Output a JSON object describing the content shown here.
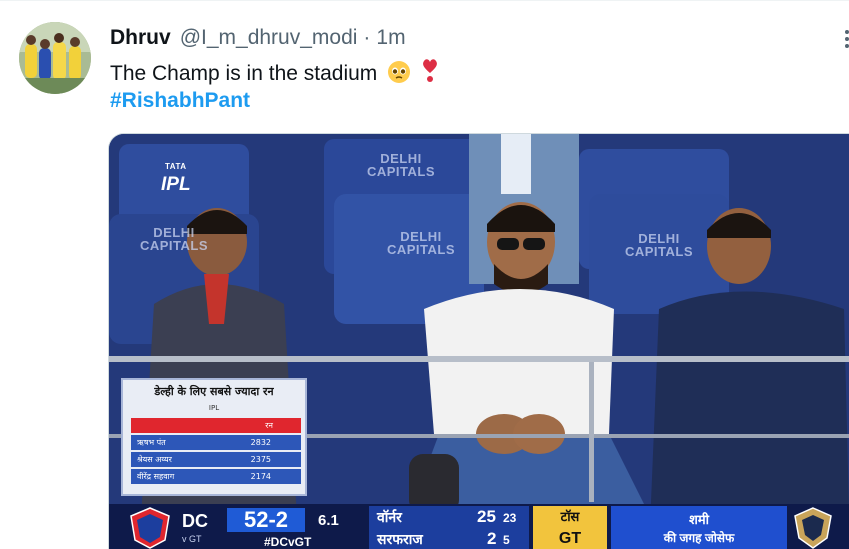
{
  "colors": {
    "text": "#0f1419",
    "secondary": "#536471",
    "link": "#1d9bf0",
    "heart": "#e0245e"
  },
  "tweet": {
    "author_name": "Dhruv",
    "handle": "@I_m_dhruv_modi",
    "separator": "·",
    "timestamp": "1m",
    "text": "The Champ is in the stadium",
    "emojis": [
      "pleading-face-icon",
      "heart-exclamation-icon"
    ],
    "hashtag": "#RishabhPant",
    "more_icon": "more-options-icon"
  },
  "media": {
    "broadcaster_logo": {
      "brand": "TATA",
      "name": "IPL"
    },
    "seat_sign_line1": "DELHI",
    "seat_sign_line2": "CAPITALS",
    "stats_card": {
      "title": "डेल्ही के लिए सबसे ज्यादा रन",
      "subtitle": "IPL",
      "column_header": "रन",
      "rows": [
        {
          "name": "ऋषभ पंत",
          "runs": "2832"
        },
        {
          "name": "श्रेयस अय्यर",
          "runs": "2375"
        },
        {
          "name": "वीरेंद्र सहवाग",
          "runs": "2174"
        }
      ]
    },
    "scorebar": {
      "team": "DC",
      "opponent": "v GT",
      "score": "52-2",
      "overs": "6.1",
      "hashtag": "#DCvGT",
      "batters": [
        {
          "name": "वॉर्नर",
          "runs": "25",
          "balls": "23"
        },
        {
          "name": "सरफराज",
          "runs": "2",
          "balls": "5"
        }
      ],
      "toss_label": "टॉस",
      "toss_team": "GT",
      "message_line1": "शमी",
      "message_line2": "की जगह जोसेफ"
    }
  }
}
